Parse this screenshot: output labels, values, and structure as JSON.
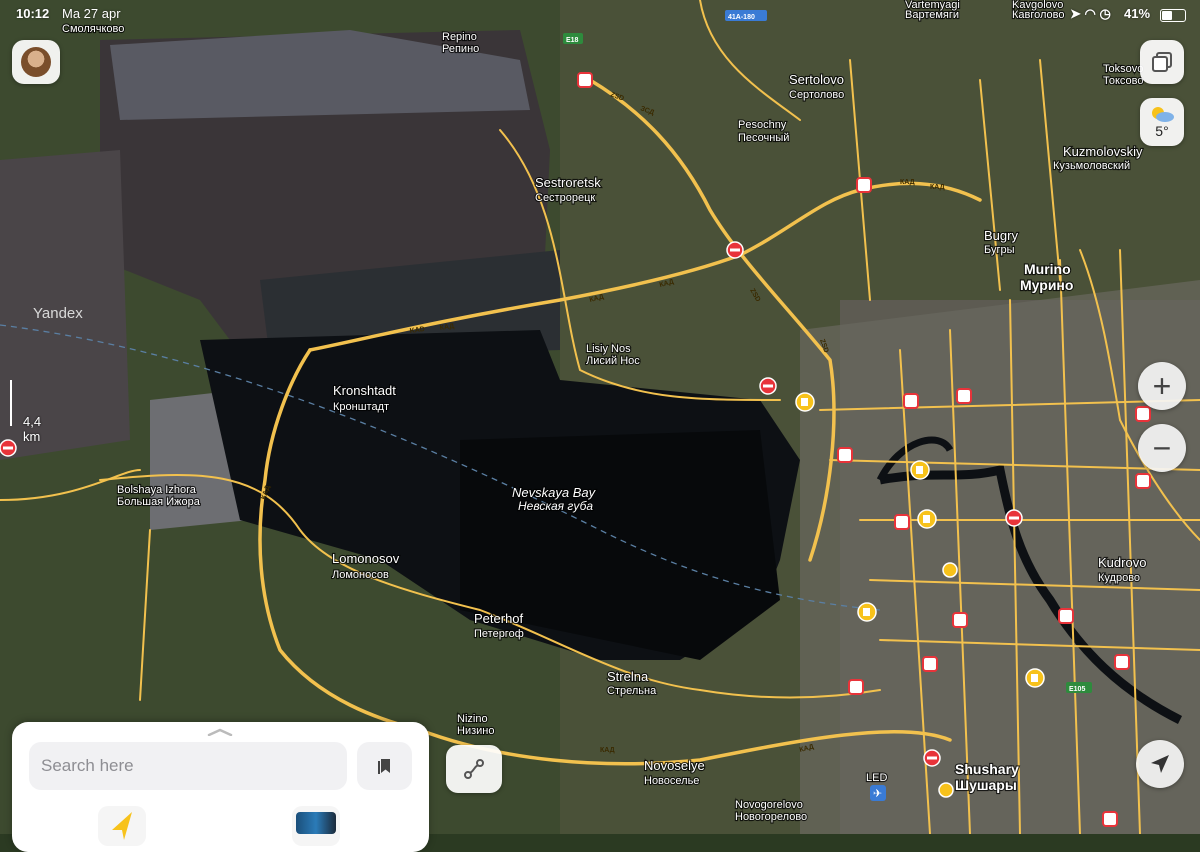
{
  "status_bar": {
    "time": "10:12",
    "date": "Ma 27 apr",
    "battery": "41%"
  },
  "watermark": "Yandex",
  "scale": "4,4 km",
  "weather": {
    "temperature": "5°"
  },
  "places": [
    {
      "en": "Sertolovo",
      "ru": "Сертолово"
    },
    {
      "en": "Pesochny",
      "ru": "Песочный"
    },
    {
      "en": "Kuzmolovskiy",
      "ru": "Кузьмоловский"
    },
    {
      "en": "Toksovo",
      "ru": "Токсово"
    },
    {
      "en": "Sestroretsk",
      "ru": "Сестрорецк"
    },
    {
      "en": "Bugry",
      "ru": "Бугры"
    },
    {
      "en": "Murino",
      "ru": "Мурино"
    },
    {
      "en": "Repino",
      "ru": "Репино"
    },
    {
      "en": "Lisiy Nos",
      "ru": "Лисий Нос"
    },
    {
      "en": "Kronshtadt",
      "ru": "Кронштадт"
    },
    {
      "en": "Bolshaya Izhora",
      "ru": "Большая Ижора"
    },
    {
      "en": "Lomonosov",
      "ru": "Ломоносов"
    },
    {
      "en": "Peterhof",
      "ru": "Петергоф"
    },
    {
      "en": "Strelna",
      "ru": "Стрельна"
    },
    {
      "en": "Kudrovo",
      "ru": "Кудрово"
    },
    {
      "en": "Nizino",
      "ru": "Низино"
    },
    {
      "en": "Novoselye",
      "ru": "Новоселье"
    },
    {
      "en": "Novogorelovo",
      "ru": "Новогорелово"
    },
    {
      "en": "Shushary",
      "ru": "Шушары"
    },
    {
      "en": "Vartemyagi",
      "ru": "Вартемяги"
    },
    {
      "en": "Kavgolovo",
      "ru": "Кавголово"
    },
    {
      "en": "Smolyachkovo",
      "ru": "Смолячково"
    }
  ],
  "bay": {
    "en": "Nevskaya Bay",
    "ru": "Невская губа"
  },
  "road_labels": {
    "kad": "КАД",
    "kad_lat": "KAD",
    "zsd": "ЗСД",
    "zsd_lat": "ZSD",
    "e18": "E18",
    "e105": "E105",
    "r41": "41A-180"
  },
  "airport": "LED",
  "controls": {
    "zoom_in": "+",
    "zoom_out": "−"
  },
  "search": {
    "placeholder": "Search here"
  },
  "colors": {
    "road": "#f2c14e",
    "water": "#0d1014",
    "incident": "#e8333a",
    "poi": "#f7c21b"
  }
}
